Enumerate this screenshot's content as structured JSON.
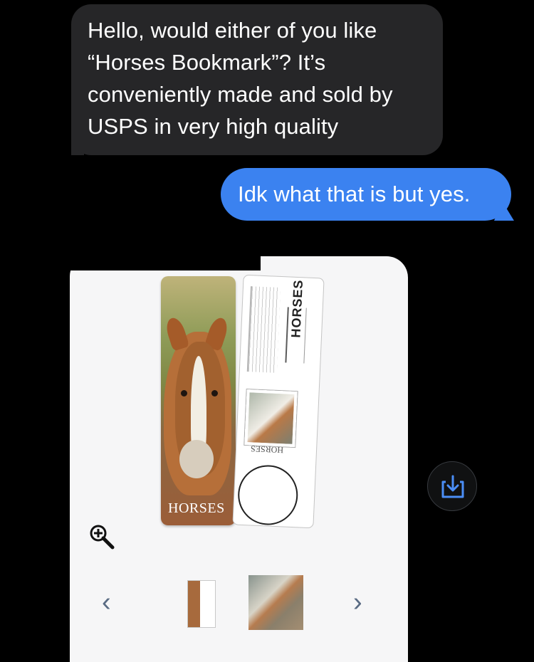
{
  "conversation": {
    "incoming_message": "Hello, would either of you like “Horses Bookmark”? It’s conveniently made and sold by USPS in very high quality",
    "outgoing_message": "Idk what that is but yes."
  },
  "image_card": {
    "bookmark_title": "HORSES",
    "postmark_title": "HORSES",
    "stamp_label": "HORSES",
    "navigation": {
      "previous": "‹",
      "next": "›"
    }
  },
  "icons": {
    "zoom": "zoom-in-icon",
    "save": "download-icon",
    "previous": "chevron-left-icon",
    "next": "chevron-right-icon"
  },
  "colors": {
    "background": "#000000",
    "incoming_bubble": "#262628",
    "outgoing_bubble": "#3b82f0",
    "save_icon": "#4b8ef6",
    "image_background": "#f6f6f7"
  }
}
